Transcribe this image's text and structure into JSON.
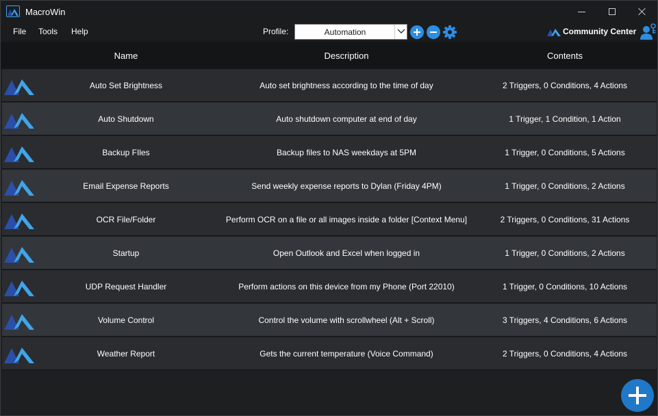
{
  "window": {
    "title": "MacroWin",
    "icon": "macrowin-logo-icon"
  },
  "menu": {
    "file": "File",
    "tools": "Tools",
    "help": "Help"
  },
  "profile": {
    "label": "Profile:",
    "selected": "Automation"
  },
  "community": {
    "label": "Community Center"
  },
  "table": {
    "headers": {
      "name": "Name",
      "description": "Description",
      "contents": "Contents"
    },
    "rows": [
      {
        "name": "Auto Set Brightness",
        "description": "Auto set brightness according to the time of day",
        "contents": "2 Triggers, 0 Conditions, 4 Actions"
      },
      {
        "name": "Auto Shutdown",
        "description": "Auto shutdown computer at end of day",
        "contents": "1 Trigger, 1 Condition, 1 Action"
      },
      {
        "name": "Backup FIles",
        "description": "Backup files to NAS weekdays at 5PM",
        "contents": "1 Trigger, 0 Conditions, 5 Actions"
      },
      {
        "name": "Email Expense Reports",
        "description": "Send weekly expense reports to Dylan (Friday 4PM)",
        "contents": "1 Trigger, 0 Conditions, 2 Actions"
      },
      {
        "name": "OCR File/Folder",
        "description": "Perform OCR on a file or all images inside a folder [Context Menu]",
        "contents": "2 Triggers, 0 Conditions, 31 Actions"
      },
      {
        "name": "Startup",
        "description": "Open Outlook and Excel when logged in",
        "contents": "1 Trigger, 0 Conditions, 2 Actions"
      },
      {
        "name": "UDP Request Handler",
        "description": "Perform actions on this device from my Phone (Port 22010)",
        "contents": "1 Trigger, 0 Conditions, 10 Actions"
      },
      {
        "name": "Volume Control",
        "description": "Control the volume with scrollwheel (Alt + Scroll)",
        "contents": "3 Triggers, 4 Conditions, 6 Actions"
      },
      {
        "name": "Weather Report",
        "description": "Gets the current temperature (Voice Command)",
        "contents": "2 Triggers, 0 Conditions, 4 Actions"
      }
    ]
  },
  "colors": {
    "accent": "#2e8de0",
    "logo_dark": "#2a4fa8",
    "logo_light": "#3fa4ea",
    "row_odd": "#2a2c2f",
    "row_even": "#33363a",
    "header_bg": "#141517"
  }
}
